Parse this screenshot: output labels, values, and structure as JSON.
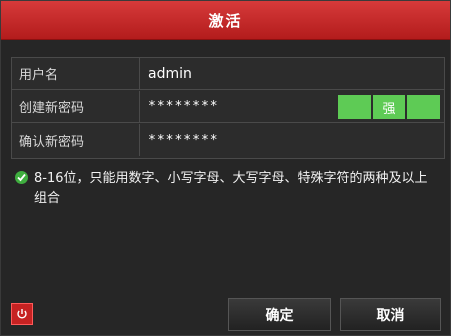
{
  "dialog": {
    "title": "激活"
  },
  "form": {
    "username_label": "用户名",
    "username_value": "admin",
    "new_password_label": "创建新密码",
    "new_password_value": "********",
    "confirm_password_label": "确认新密码",
    "confirm_password_value": "********",
    "strength_label": "强",
    "strength_color": "#5ecb55"
  },
  "hint": {
    "text": "8-16位，只能用数字、小写字母、大写字母、特殊字符的两种及以上组合",
    "icon": "check-circle-icon"
  },
  "footer": {
    "power_icon": "power-icon",
    "ok_label": "确定",
    "cancel_label": "取消"
  },
  "colors": {
    "titlebar": "#c62828",
    "background": "#262626"
  }
}
